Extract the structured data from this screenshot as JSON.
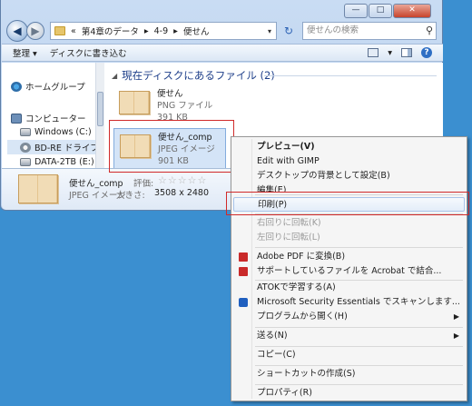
{
  "window": {
    "caption": {
      "minimize": "—",
      "maximize": "□",
      "close": "✕"
    },
    "nav": {
      "back_icon": "◀",
      "forward_icon": "▶"
    },
    "address": {
      "chevrons": "«",
      "crumbs": [
        "第4章のデータ",
        "4-9",
        "便せん"
      ],
      "separator": "▸",
      "dropdown": "▾"
    },
    "refresh_icon": "↻",
    "search": {
      "placeholder": "便せんの検索",
      "icon": "⚲"
    },
    "toolbar": {
      "organize": "整理 ▾",
      "burn": "ディスクに書き込む",
      "view_dropdown": "▾",
      "help": "?"
    },
    "sidebar": [
      {
        "label": "ホームグループ",
        "icon": "homegroup-icon"
      },
      {
        "label": "コンピューター",
        "icon": "computer-icon"
      },
      {
        "label": "Windows (C:)",
        "icon": "drive-icon"
      },
      {
        "label": "BD-RE ドライブ",
        "icon": "bd-drive-icon",
        "selected": true
      },
      {
        "label": "DATA-2TB (E:)",
        "icon": "drive-icon"
      }
    ],
    "group": {
      "chevron": "◢",
      "title": "現在ディスクにあるファイル (2)"
    },
    "files": [
      {
        "name": "便せん",
        "type": "PNG ファイル",
        "size": "391 KB"
      },
      {
        "name": "便せん_comp",
        "type": "JPEG イメージ",
        "size": "901 KB",
        "selected": true
      }
    ],
    "details": {
      "name": "便せん_comp",
      "type": "JPEG イメージ",
      "rating_label": "評価:",
      "stars": "☆☆☆☆☆",
      "size_label": "大きさ:",
      "size": "3508 x 2480"
    }
  },
  "context_menu": {
    "items": [
      {
        "label": "プレビュー(V)",
        "bold": true
      },
      {
        "label": "Edit with GIMP"
      },
      {
        "label": "デスクトップの背景として設定(B)"
      },
      {
        "label": "編集(E)"
      },
      {
        "label": "印刷(P)",
        "highlight": true
      },
      {
        "label": "右回りに回転(K)",
        "disabled": true
      },
      {
        "label": "左回りに回転(L)",
        "disabled": true
      },
      {
        "label": "Adobe PDF に変換(B)",
        "icon": "pdf-icon"
      },
      {
        "label": "サポートしているファイルを Acrobat で結合...",
        "icon": "pdf-icon"
      },
      {
        "label": "ATOKで学習する(A)"
      },
      {
        "label": "Microsoft Security Essentials でスキャンします...",
        "icon": "shield-icon"
      },
      {
        "label": "プログラムから開く(H)",
        "submenu": true
      },
      {
        "label": "送る(N)",
        "submenu": true
      },
      {
        "label": "コピー(C)"
      },
      {
        "label": "ショートカットの作成(S)"
      },
      {
        "label": "プロパティ(R)"
      }
    ],
    "submenu_arrow": "▶"
  }
}
